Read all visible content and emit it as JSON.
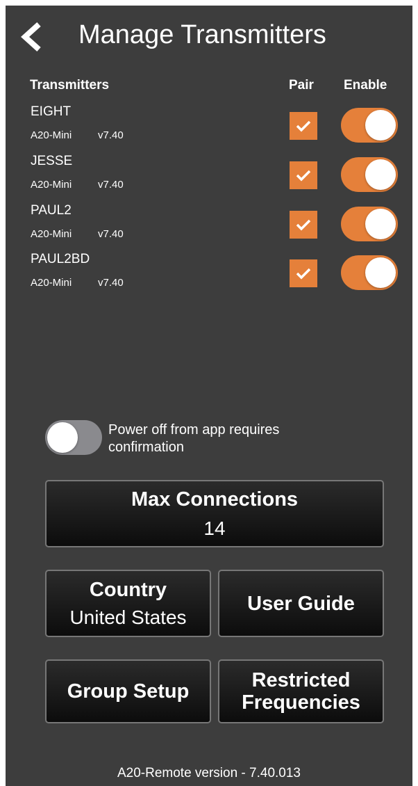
{
  "header": {
    "title": "Manage Transmitters",
    "back_icon": "chevron-left-icon"
  },
  "columns": {
    "transmitters": "Transmitters",
    "pair": "Pair",
    "enable": "Enable"
  },
  "transmitters": [
    {
      "name": "EIGHT",
      "model": "A20-Mini",
      "version": "v7.40",
      "paired": true,
      "enabled": true
    },
    {
      "name": "JESSE",
      "model": "A20-Mini",
      "version": "v7.40",
      "paired": true,
      "enabled": true
    },
    {
      "name": "PAUL2",
      "model": "A20-Mini",
      "version": "v7.40",
      "paired": true,
      "enabled": true
    },
    {
      "name": "PAUL2BD",
      "model": "A20-Mini",
      "version": "v7.40",
      "paired": true,
      "enabled": true
    }
  ],
  "power_confirm": {
    "label": "Power off from app requires confirmation",
    "enabled": false
  },
  "buttons": {
    "max_connections": {
      "title": "Max Connections",
      "value": "14"
    },
    "country": {
      "title": "Country",
      "value": "United States"
    },
    "user_guide": "User Guide",
    "group_setup": "Group Setup",
    "restricted": "Restricted\nFrequencies"
  },
  "footer": "A20-Remote version - 7.40.013",
  "colors": {
    "accent": "#e5803a",
    "background": "#3d3d3d",
    "toggle_off": "#8a8a8e"
  }
}
